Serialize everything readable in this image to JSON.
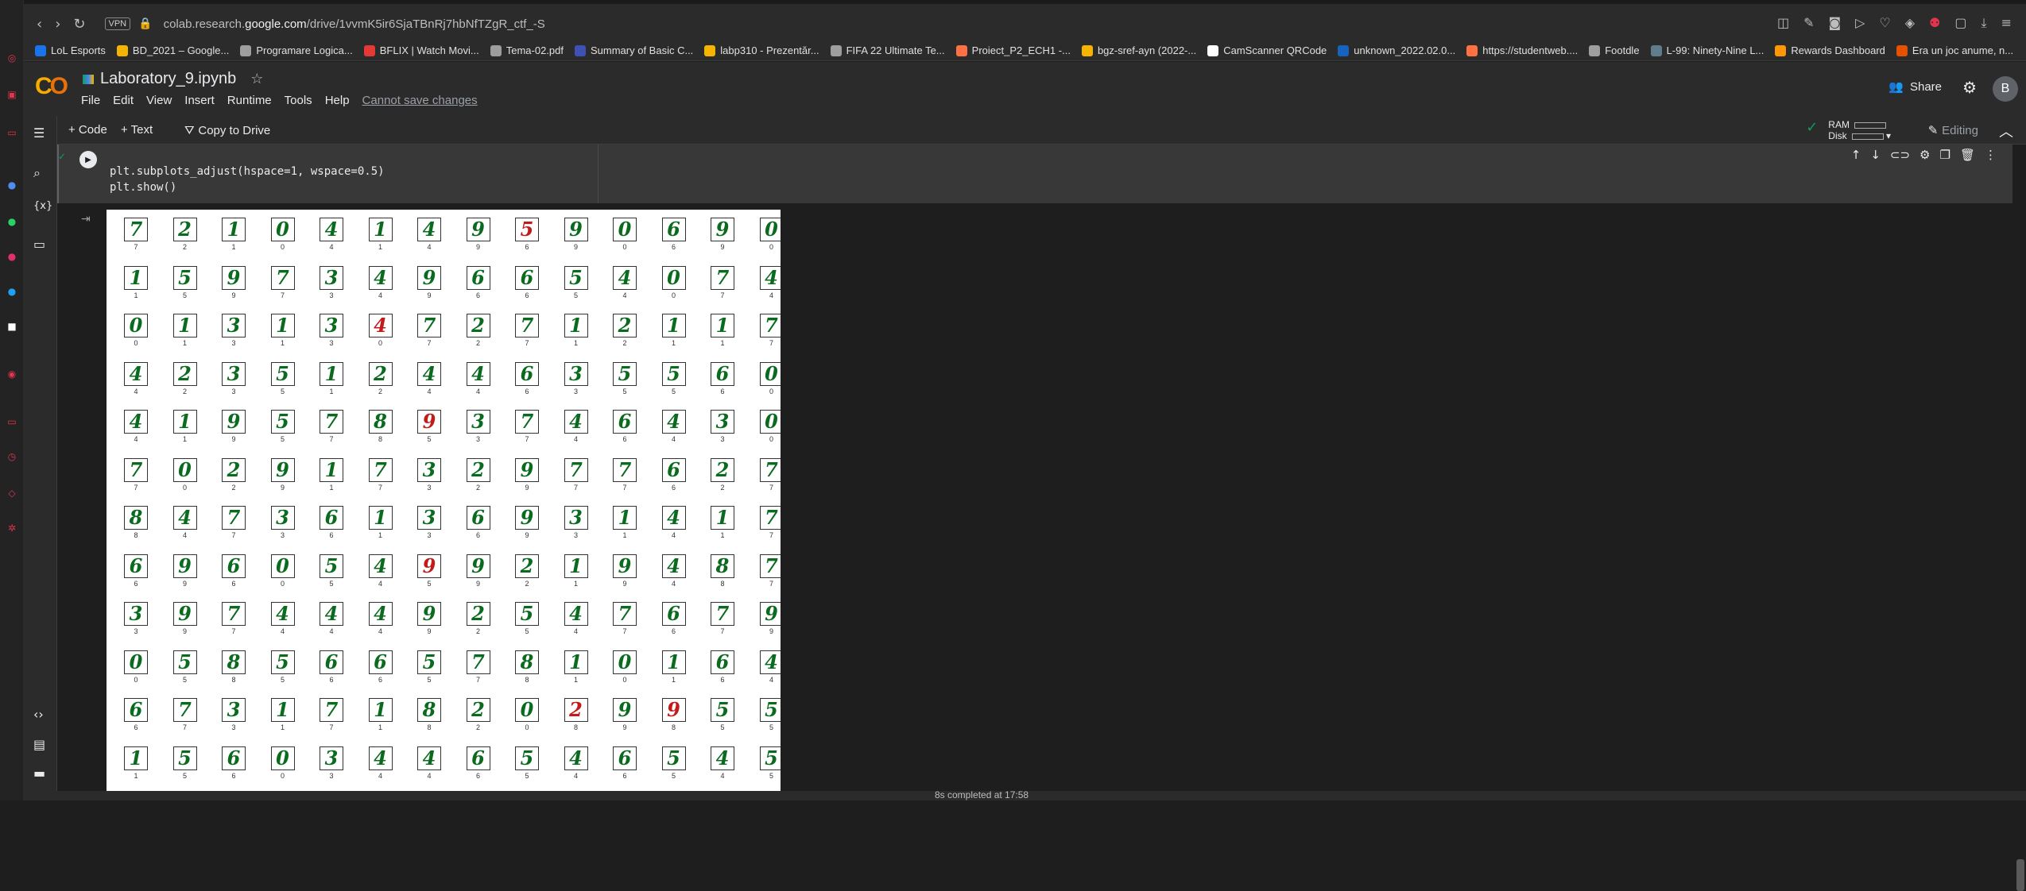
{
  "browser": {
    "url_prefix": "colab.research.",
    "url_domain": "google.com",
    "url_path": "/drive/1vvmK5ir6SjaTBnRj7hbNfTZgR_ctf_-S",
    "vpn_label": "VPN"
  },
  "bookmarks": [
    {
      "label": "LoL Esports",
      "color": "#1a73e8"
    },
    {
      "label": "BD_2021 – Google...",
      "color": "#f4b400"
    },
    {
      "label": "Programare Logica...",
      "color": "#9e9e9e"
    },
    {
      "label": "BFLIX | Watch Movi...",
      "color": "#e53935"
    },
    {
      "label": "Tema-02.pdf",
      "color": "#9e9e9e"
    },
    {
      "label": "Summary of Basic C...",
      "color": "#3f51b5"
    },
    {
      "label": "labp310 - Prezentăr...",
      "color": "#f4b400"
    },
    {
      "label": "FIFA 22 Ultimate Te...",
      "color": "#9e9e9e"
    },
    {
      "label": "Proiect_P2_ECH1 -...",
      "color": "#ff7043"
    },
    {
      "label": "bgz-sref-ayn (2022-...",
      "color": "#f4b400"
    },
    {
      "label": "CamScanner QRCode",
      "color": "#ffffff"
    },
    {
      "label": "unknown_2022.02.0...",
      "color": "#1565c0"
    },
    {
      "label": "https://studentweb....",
      "color": "#ff7043"
    },
    {
      "label": "Footdle",
      "color": "#9e9e9e"
    },
    {
      "label": "L-99: Ninety-Nine L...",
      "color": "#607d8b"
    },
    {
      "label": "Rewards Dashboard",
      "color": "#ff9800"
    },
    {
      "label": "Era un joc anume, n...",
      "color": "#e65100"
    }
  ],
  "notebook": {
    "title": "Laboratory_9.ipynb",
    "menu": [
      "File",
      "Edit",
      "View",
      "Insert",
      "Runtime",
      "Tools",
      "Help"
    ],
    "cannot_save": "Cannot save changes",
    "share_label": "Share",
    "avatar_letter": "B"
  },
  "toolbar": {
    "code_label": "+ Code",
    "text_label": "+ Text",
    "copy_label": "Copy to Drive",
    "ram_label": "RAM",
    "disk_label": "Disk",
    "editing_label": "Editing"
  },
  "cell": {
    "code_lines": "plt.subplots_adjust(hspace=1, wspace=0.5)\nplt.show()"
  },
  "status": {
    "text": "8s   completed at 17:58"
  },
  "colors": {
    "correct": "#0a6b1f",
    "incorrect": "#c21b1b"
  },
  "digits": [
    [
      [
        "7",
        7
      ],
      [
        "2",
        2
      ],
      [
        "1",
        1
      ],
      [
        "0",
        0
      ],
      [
        "4",
        4
      ],
      [
        "1",
        1
      ],
      [
        "4",
        4
      ],
      [
        "9",
        9
      ],
      [
        "5",
        6
      ],
      [
        "9",
        9
      ],
      [
        "0",
        0
      ],
      [
        "6",
        6
      ],
      [
        "9",
        9
      ],
      [
        "0",
        0
      ]
    ],
    [
      [
        "1",
        1
      ],
      [
        "5",
        5
      ],
      [
        "9",
        9
      ],
      [
        "7",
        7
      ],
      [
        "3",
        3
      ],
      [
        "4",
        4
      ],
      [
        "9",
        9
      ],
      [
        "6",
        6
      ],
      [
        "6",
        6
      ],
      [
        "5",
        5
      ],
      [
        "4",
        4
      ],
      [
        "0",
        0
      ],
      [
        "7",
        7
      ],
      [
        "4",
        4
      ]
    ],
    [
      [
        "0",
        0
      ],
      [
        "1",
        1
      ],
      [
        "3",
        3
      ],
      [
        "1",
        1
      ],
      [
        "3",
        3
      ],
      [
        "4",
        0
      ],
      [
        "7",
        7
      ],
      [
        "2",
        2
      ],
      [
        "7",
        7
      ],
      [
        "1",
        1
      ],
      [
        "2",
        2
      ],
      [
        "1",
        1
      ],
      [
        "1",
        1
      ],
      [
        "7",
        7
      ]
    ],
    [
      [
        "4",
        4
      ],
      [
        "2",
        2
      ],
      [
        "3",
        3
      ],
      [
        "5",
        5
      ],
      [
        "1",
        1
      ],
      [
        "2",
        2
      ],
      [
        "4",
        4
      ],
      [
        "4",
        4
      ],
      [
        "6",
        6
      ],
      [
        "3",
        3
      ],
      [
        "5",
        5
      ],
      [
        "5",
        5
      ],
      [
        "6",
        6
      ],
      [
        "0",
        0
      ]
    ],
    [
      [
        "4",
        4
      ],
      [
        "1",
        1
      ],
      [
        "9",
        9
      ],
      [
        "5",
        5
      ],
      [
        "7",
        7
      ],
      [
        "8",
        8
      ],
      [
        "9",
        5
      ],
      [
        "3",
        3
      ],
      [
        "7",
        7
      ],
      [
        "4",
        4
      ],
      [
        "6",
        6
      ],
      [
        "4",
        4
      ],
      [
        "3",
        3
      ],
      [
        "0",
        0
      ]
    ],
    [
      [
        "7",
        7
      ],
      [
        "0",
        0
      ],
      [
        "2",
        2
      ],
      [
        "9",
        9
      ],
      [
        "1",
        1
      ],
      [
        "7",
        7
      ],
      [
        "3",
        3
      ],
      [
        "2",
        2
      ],
      [
        "9",
        9
      ],
      [
        "7",
        7
      ],
      [
        "7",
        7
      ],
      [
        "6",
        6
      ],
      [
        "2",
        2
      ],
      [
        "7",
        7
      ]
    ],
    [
      [
        "8",
        8
      ],
      [
        "4",
        4
      ],
      [
        "7",
        7
      ],
      [
        "3",
        3
      ],
      [
        "6",
        6
      ],
      [
        "1",
        1
      ],
      [
        "3",
        3
      ],
      [
        "6",
        6
      ],
      [
        "9",
        9
      ],
      [
        "3",
        3
      ],
      [
        "1",
        1
      ],
      [
        "4",
        4
      ],
      [
        "1",
        1
      ],
      [
        "7",
        7
      ]
    ],
    [
      [
        "6",
        6
      ],
      [
        "9",
        9
      ],
      [
        "6",
        6
      ],
      [
        "0",
        0
      ],
      [
        "5",
        5
      ],
      [
        "4",
        4
      ],
      [
        "9",
        5
      ],
      [
        "9",
        9
      ],
      [
        "2",
        2
      ],
      [
        "1",
        1
      ],
      [
        "9",
        9
      ],
      [
        "4",
        4
      ],
      [
        "8",
        8
      ],
      [
        "7",
        7
      ]
    ],
    [
      [
        "3",
        3
      ],
      [
        "9",
        9
      ],
      [
        "7",
        7
      ],
      [
        "4",
        4
      ],
      [
        "4",
        4
      ],
      [
        "4",
        4
      ],
      [
        "9",
        9
      ],
      [
        "2",
        2
      ],
      [
        "5",
        5
      ],
      [
        "4",
        4
      ],
      [
        "7",
        7
      ],
      [
        "6",
        6
      ],
      [
        "7",
        7
      ],
      [
        "9",
        9
      ]
    ],
    [
      [
        "0",
        0
      ],
      [
        "5",
        5
      ],
      [
        "8",
        8
      ],
      [
        "5",
        5
      ],
      [
        "6",
        6
      ],
      [
        "6",
        6
      ],
      [
        "5",
        5
      ],
      [
        "7",
        7
      ],
      [
        "8",
        8
      ],
      [
        "1",
        1
      ],
      [
        "0",
        0
      ],
      [
        "1",
        1
      ],
      [
        "6",
        6
      ],
      [
        "4",
        4
      ]
    ],
    [
      [
        "6",
        6
      ],
      [
        "7",
        7
      ],
      [
        "3",
        3
      ],
      [
        "1",
        1
      ],
      [
        "7",
        7
      ],
      [
        "1",
        1
      ],
      [
        "8",
        8
      ],
      [
        "2",
        2
      ],
      [
        "0",
        0
      ],
      [
        "2",
        8
      ],
      [
        "9",
        9
      ],
      [
        "9",
        8
      ],
      [
        "5",
        5
      ],
      [
        "5",
        5
      ]
    ],
    [
      [
        "1",
        1
      ],
      [
        "5",
        5
      ],
      [
        "6",
        6
      ],
      [
        "0",
        0
      ],
      [
        "3",
        3
      ],
      [
        "4",
        4
      ],
      [
        "4",
        4
      ],
      [
        "6",
        6
      ],
      [
        "5",
        5
      ],
      [
        "4",
        4
      ],
      [
        "6",
        6
      ],
      [
        "5",
        5
      ],
      [
        "4",
        4
      ],
      [
        "5",
        5
      ]
    ]
  ]
}
